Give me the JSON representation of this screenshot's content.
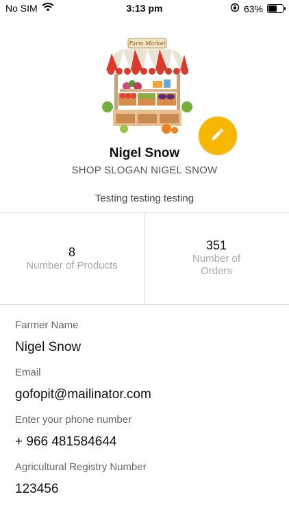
{
  "status_bar": {
    "carrier": "No SIM",
    "time": "3:13 pm",
    "battery_percent": "63%",
    "battery_level": 0.63
  },
  "header": {
    "image_name": "farm-market-stall",
    "image_text": "Farm Market"
  },
  "shop": {
    "name": "Nigel Snow",
    "slogan": "SHOP SLOGAN NIGEL SNOW",
    "description": "Testing testing testing"
  },
  "stats": {
    "products_count": "8",
    "products_label": "Number of Products",
    "orders_count": "351",
    "orders_label_line1": "Number of",
    "orders_label_line2": "Orders"
  },
  "fields": [
    {
      "label": "Farmer Name",
      "value": "Nigel Snow"
    },
    {
      "label": "Email",
      "value": "gofopit@mailinator.com"
    },
    {
      "label": "Enter your phone number",
      "value": "+ 966 481584644"
    },
    {
      "label": "Agricultural Registry Number",
      "value": "123456"
    }
  ],
  "colors": {
    "accent": "#F7B600",
    "divider": "#d8d8d8",
    "muted": "#a7a7a7"
  },
  "icons": {
    "edit": "pencil-icon",
    "wifi": "wifi-icon",
    "orientation_lock": "orientation-lock-icon",
    "battery": "battery-icon"
  }
}
